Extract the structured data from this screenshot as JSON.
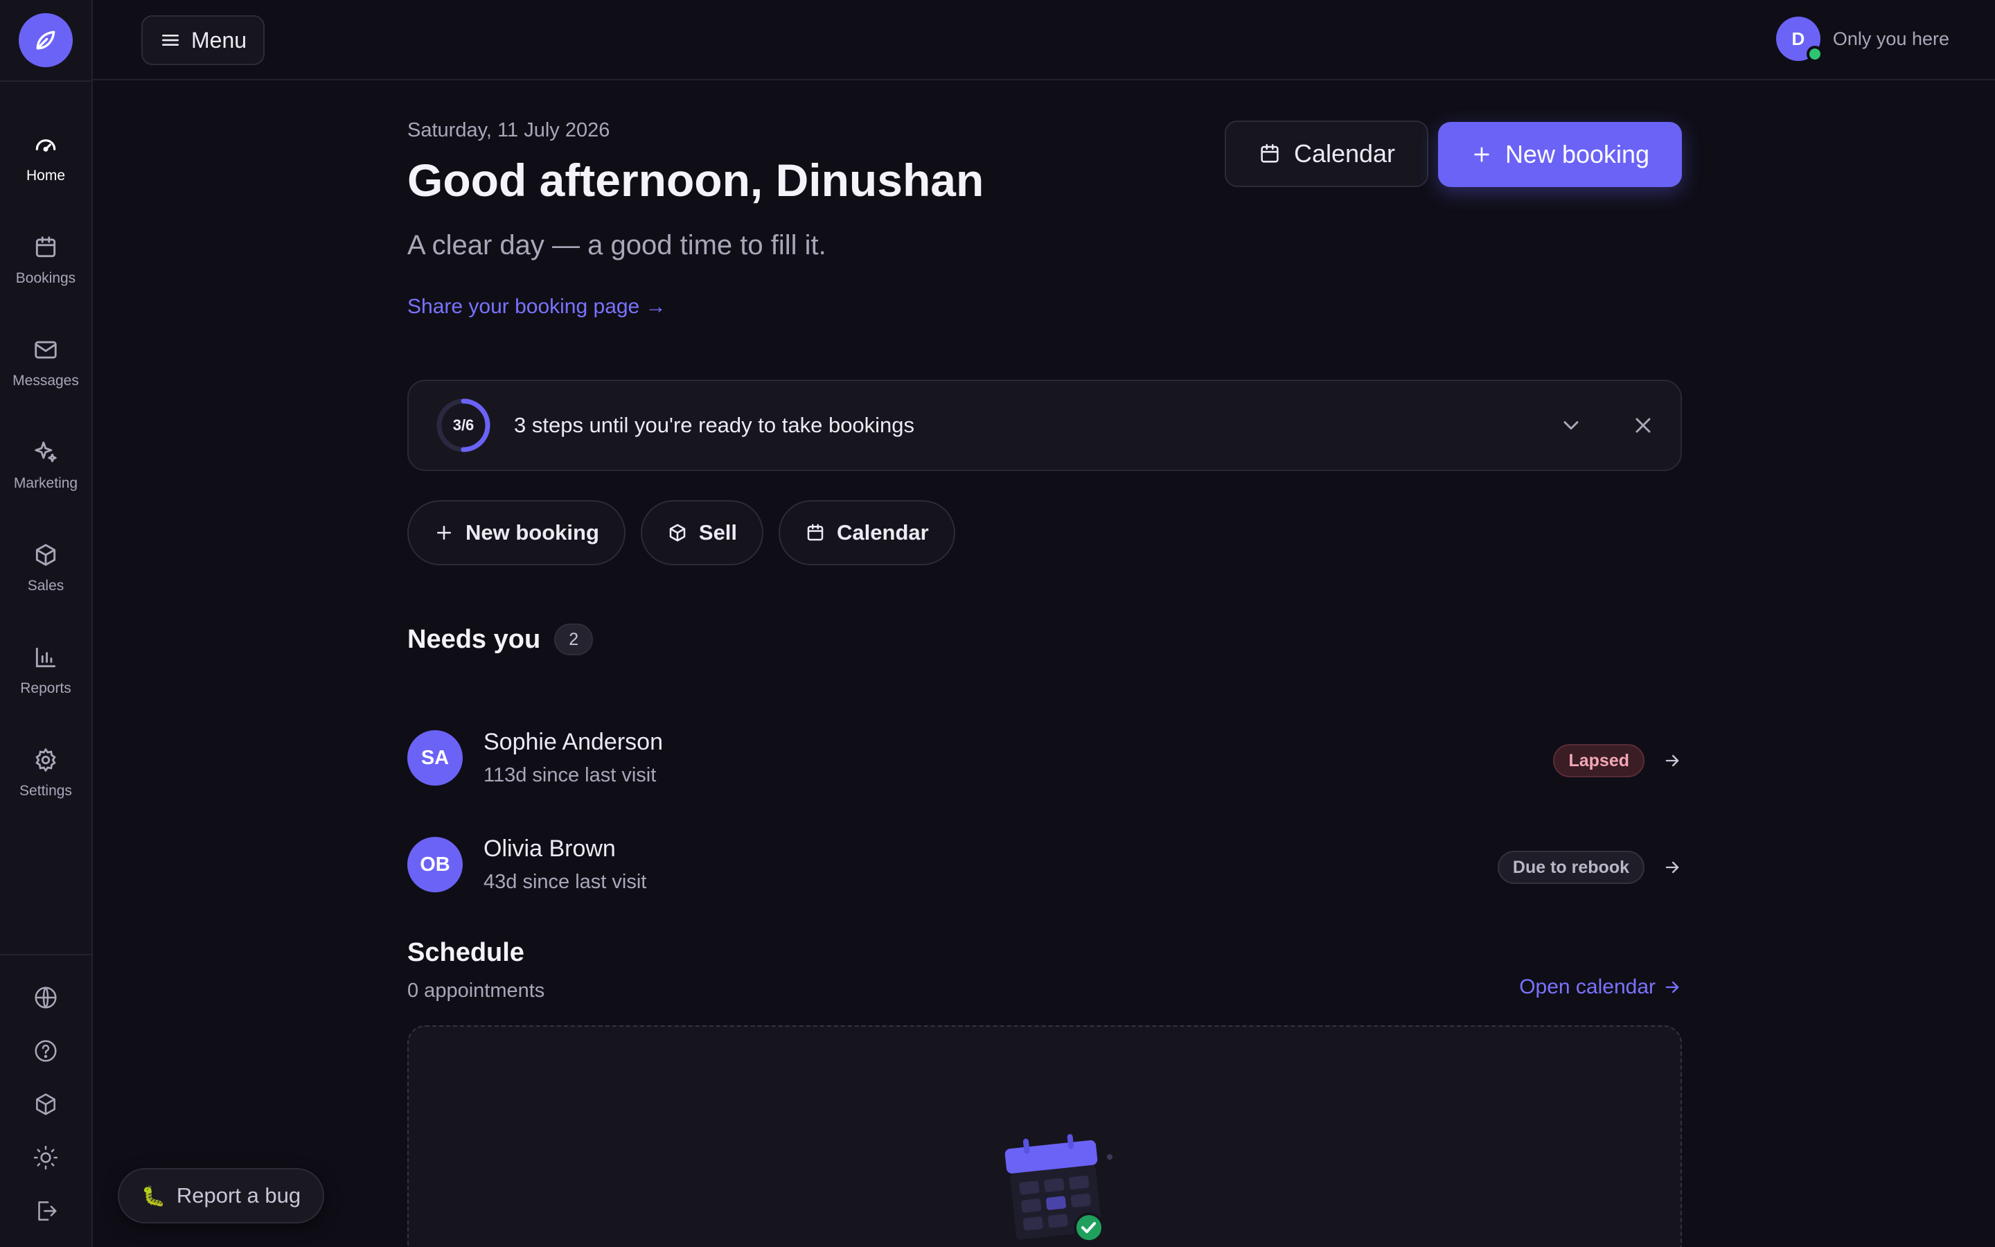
{
  "sidebar": {
    "items": [
      {
        "label": "Home",
        "icon": "gauge-icon"
      },
      {
        "label": "Bookings",
        "icon": "calendar-icon"
      },
      {
        "label": "Messages",
        "icon": "mail-icon"
      },
      {
        "label": "Marketing",
        "icon": "sparkle-icon"
      },
      {
        "label": "Sales",
        "icon": "box-icon"
      },
      {
        "label": "Reports",
        "icon": "bar-chart-icon"
      },
      {
        "label": "Settings",
        "icon": "gear-icon"
      }
    ],
    "active": "Home",
    "bottom_icons": [
      "globe-icon",
      "help-icon",
      "box-icon",
      "sun-icon",
      "logout-icon"
    ]
  },
  "topbar": {
    "menu_label": "Menu",
    "user_initial": "D",
    "user_status_text": "Only you here"
  },
  "header": {
    "date": "Saturday, 11 July 2026",
    "greeting": "Good afternoon, Dinushan",
    "subline": "A clear day — a good time to fill it.",
    "share_link": "Share your booking page →",
    "calendar_button": "Calendar",
    "new_booking_button": "New booking"
  },
  "setup": {
    "progress_label": "3/6",
    "progress_fraction": 0.5,
    "text": "3 steps until you're ready to take bookings"
  },
  "quick_actions": [
    {
      "label": "New booking",
      "icon": "plus-icon"
    },
    {
      "label": "Sell",
      "icon": "box-icon"
    },
    {
      "label": "Calendar",
      "icon": "calendar-icon"
    }
  ],
  "needs_you": {
    "title": "Needs you",
    "count": "2",
    "clients": [
      {
        "initials": "SA",
        "name": "Sophie Anderson",
        "sub": "113d since last visit",
        "badge": "Lapsed",
        "badge_type": "lapsed"
      },
      {
        "initials": "OB",
        "name": "Olivia Brown",
        "sub": "43d since last visit",
        "badge": "Due to rebook",
        "badge_type": "due"
      }
    ]
  },
  "schedule": {
    "title": "Schedule",
    "count_text": "0 appointments",
    "open_calendar": "Open calendar"
  },
  "report_bug": "Report a bug",
  "colors": {
    "accent": "#6b63f6",
    "link": "#7a73ff",
    "background": "#0f0e17",
    "online": "#2fc46f"
  }
}
